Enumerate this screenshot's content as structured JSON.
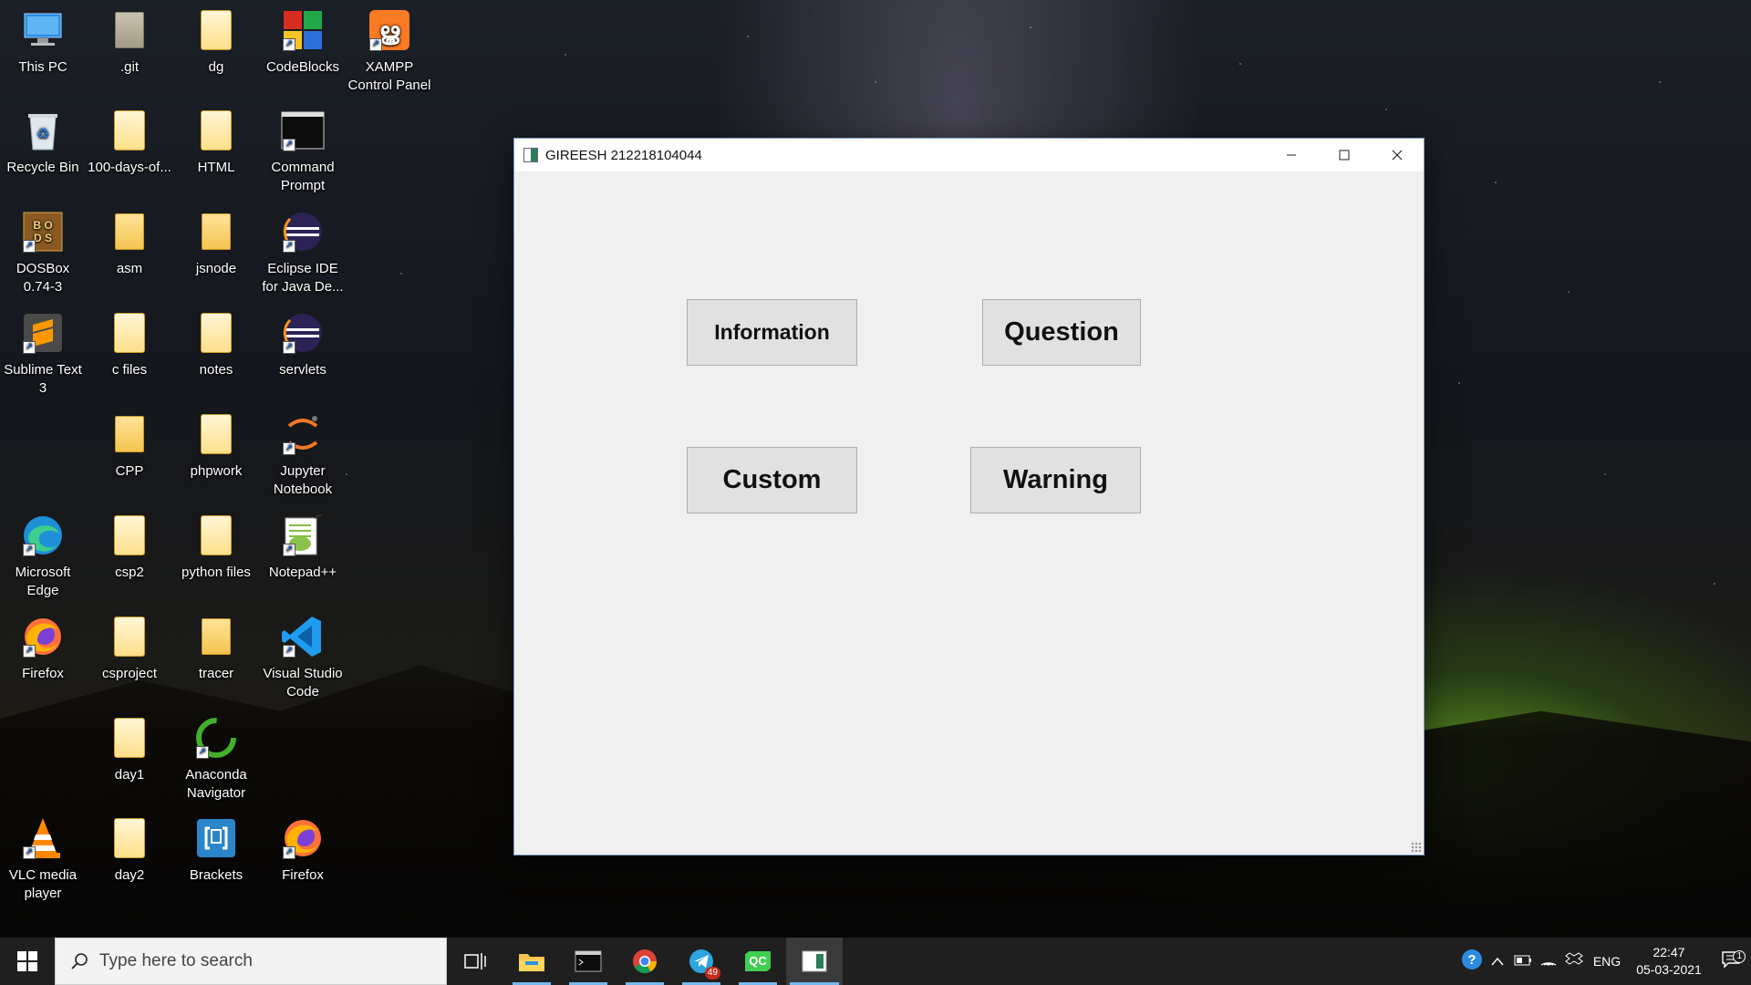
{
  "desktop": {
    "icons": [
      {
        "label": "This PC",
        "icon": "computer-icon"
      },
      {
        "label": "Recycle Bin",
        "icon": "recycle-bin-icon"
      },
      {
        "label": "DOSBox 0.74-3",
        "icon": "dosbox-icon"
      },
      {
        "label": "Sublime Text 3",
        "icon": "sublime-text-icon"
      },
      {
        "label": "Microsoft Edge",
        "icon": "edge-icon"
      },
      {
        "label": "Firefox",
        "icon": "firefox-icon"
      },
      {
        "label": "VLC media player",
        "icon": "vlc-icon"
      },
      {
        "label": ".git",
        "icon": "folder-icon"
      },
      {
        "label": "100-days-of...",
        "icon": "folder-icon"
      },
      {
        "label": "asm",
        "icon": "folder-icon"
      },
      {
        "label": "c files",
        "icon": "folder-icon"
      },
      {
        "label": "CPP",
        "icon": "folder-icon"
      },
      {
        "label": "csp2",
        "icon": "folder-icon"
      },
      {
        "label": "csproject",
        "icon": "folder-icon"
      },
      {
        "label": "day1",
        "icon": "folder-icon"
      },
      {
        "label": "day2",
        "icon": "folder-icon"
      },
      {
        "label": "dg",
        "icon": "folder-icon"
      },
      {
        "label": "HTML",
        "icon": "folder-icon"
      },
      {
        "label": "jsnode",
        "icon": "folder-icon"
      },
      {
        "label": "notes",
        "icon": "folder-icon"
      },
      {
        "label": "phpwork",
        "icon": "folder-icon"
      },
      {
        "label": "python files",
        "icon": "folder-icon"
      },
      {
        "label": "tracer",
        "icon": "folder-icon"
      },
      {
        "label": "Anaconda Navigator",
        "icon": "anaconda-icon"
      },
      {
        "label": "Brackets",
        "icon": "brackets-icon"
      },
      {
        "label": "CodeBlocks",
        "icon": "codeblocks-icon"
      },
      {
        "label": "Command Prompt",
        "icon": "command-prompt-icon"
      },
      {
        "label": "Eclipse IDE for Java De...",
        "icon": "eclipse-icon"
      },
      {
        "label": "servlets",
        "icon": "eclipse-icon"
      },
      {
        "label": "Jupyter Notebook",
        "icon": "jupyter-icon"
      },
      {
        "label": "Notepad++",
        "icon": "notepadpp-icon"
      },
      {
        "label": "Visual Studio Code",
        "icon": "vscode-icon"
      },
      {
        "label": "Firefox",
        "icon": "firefox-icon"
      },
      {
        "label": "XAMPP Control Panel",
        "icon": "xampp-icon"
      }
    ]
  },
  "window": {
    "title": "GIREESH 212218104044",
    "buttons": {
      "information": "Information",
      "question": "Question",
      "custom": "Custom",
      "warning": "Warning"
    }
  },
  "taskbar": {
    "search_placeholder": "Type here to search",
    "telegram_badge": "49",
    "qt_label": "QC",
    "language": "ENG",
    "time": "22:47",
    "date": "05-03-2021",
    "notification_count": "1"
  },
  "colors": {
    "window_bg": "#f0f0f0",
    "button_bg": "#e1e1e1",
    "taskbar_bg": "#1f1f1f",
    "accent": "#76b9ed"
  }
}
